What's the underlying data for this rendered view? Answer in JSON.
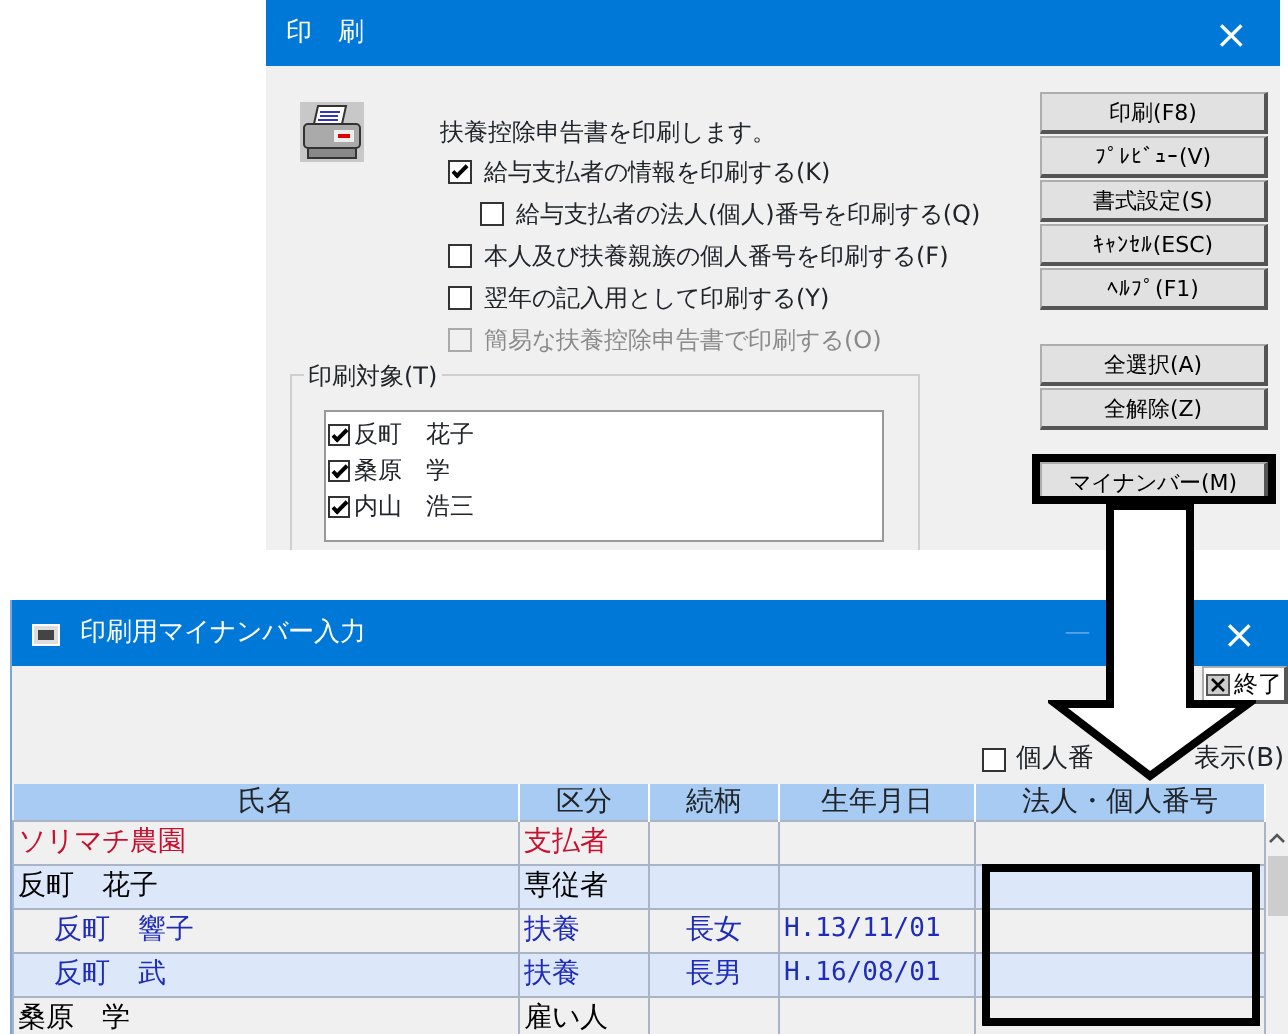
{
  "print_dialog": {
    "title": "印　刷",
    "close": "×",
    "message": "扶養控除申告書を印刷します。",
    "options": [
      {
        "label": "給与支払者の情報を印刷する(K)",
        "checked": true,
        "disabled": false,
        "children": [
          {
            "label": "給与支払者の法人(個人)番号を印刷する(Q)",
            "checked": false,
            "disabled": false
          }
        ]
      },
      {
        "label": "本人及び扶養親族の個人番号を印刷する(F)",
        "checked": false,
        "disabled": false
      },
      {
        "label": "翌年の記入用として印刷する(Y)",
        "checked": false,
        "disabled": false
      },
      {
        "label": "簡易な扶養控除申告書で印刷する(O)",
        "checked": false,
        "disabled": true
      }
    ],
    "buttons": [
      "印刷(F8)",
      "ﾌﾟﾚﾋﾞｭｰ(V)",
      "書式設定(S)",
      "ｷｬﾝｾﾙ(ESC)",
      "ﾍﾙﾌﾟ(F1)"
    ],
    "selection_buttons": [
      "全選択(A)",
      "全解除(Z)"
    ],
    "mynumber_button": {
      "label": "マイナンバー(M)",
      "highlighted": true
    },
    "targets": {
      "legend": "印刷対象(T)",
      "items": [
        {
          "label": "反町　花子",
          "checked": true
        },
        {
          "label": "桑原　学",
          "checked": true
        },
        {
          "label": "内山　浩三",
          "checked": true
        }
      ]
    }
  },
  "mynumber_window": {
    "title": "印刷用マイナンバー入力",
    "minimize": "—",
    "close": "×",
    "exit_button": "終了",
    "show_number": {
      "checked": false,
      "label_parts": [
        "個人番",
        "表示(B)"
      ]
    },
    "table": {
      "columns": [
        "氏名",
        "区分",
        "続柄",
        "生年月日",
        "法人・個人番号"
      ],
      "number_column_highlighted": true,
      "rows": [
        {
          "kind": "payer",
          "cells": [
            "ソリマチ農園",
            "支払者",
            "",
            "",
            ""
          ]
        },
        {
          "kind": "employee",
          "cells": [
            "反町　花子",
            "専従者",
            "",
            "",
            ""
          ]
        },
        {
          "kind": "dependent",
          "cells": [
            "反町　響子",
            "扶養",
            "長女",
            "H.13/11/01",
            ""
          ]
        },
        {
          "kind": "dependent",
          "cells": [
            "反町　武",
            "扶養",
            "長男",
            "H.16/08/01",
            ""
          ]
        },
        {
          "kind": "employee",
          "cells": [
            "桑原　学",
            "雇い人",
            "",
            "",
            ""
          ]
        }
      ]
    }
  }
}
